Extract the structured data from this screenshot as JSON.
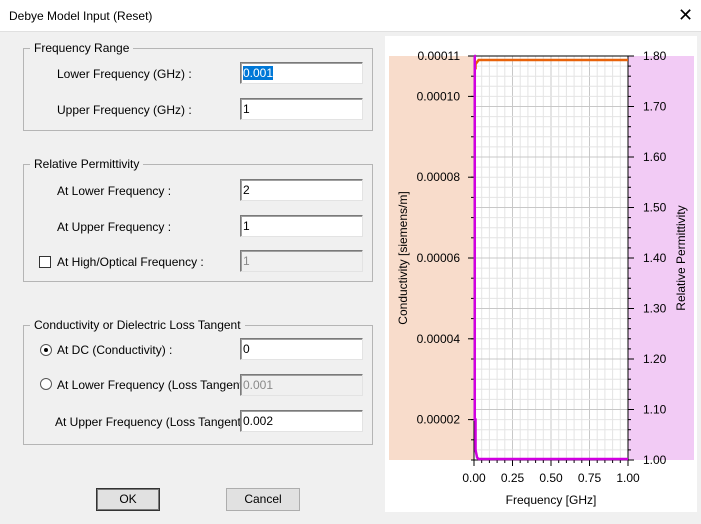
{
  "window": {
    "title": "Debye Model Input (Reset)",
    "close_icon": "close-icon"
  },
  "frequency_range": {
    "legend": "Frequency Range",
    "lower_label": "Lower Frequency (GHz) :",
    "lower_value": "0.001",
    "upper_label": "Upper Frequency (GHz) :",
    "upper_value": "1"
  },
  "relative_permittivity": {
    "legend": "Relative Permittivity",
    "lower_label": "At Lower Frequency :",
    "lower_value": "2",
    "upper_label": "At Upper Frequency :",
    "upper_value": "1",
    "optical_label": "At High/Optical Frequency :",
    "optical_value": "1",
    "optical_checked": false
  },
  "conductivity": {
    "legend": "Conductivity or Dielectric Loss Tangent",
    "dc_label": "At DC (Conductivity) :",
    "dc_value": "0",
    "dc_selected": true,
    "lower_label": "At Lower Frequency (Loss Tangent) :",
    "lower_value": "0.001",
    "upper_label": "At Upper Frequency (Loss Tangent) :",
    "upper_value": "0.002"
  },
  "buttons": {
    "ok": "OK",
    "cancel": "Cancel"
  },
  "chart_data": {
    "type": "line",
    "xlabel": "Frequency [GHz]",
    "ylabel_left": "Conductivity [siemens/m]",
    "ylabel_right": "Relative Permittivity",
    "xlim": [
      0,
      1
    ],
    "ylim_left": [
      1e-05,
      0.00011
    ],
    "ylim_right": [
      1.0,
      1.8
    ],
    "x_ticks": [
      "0.00",
      "0.25",
      "0.50",
      "0.75",
      "1.00"
    ],
    "y_left_ticks": [
      "0.00011",
      "0.00010",
      "0.00008",
      "0.00006",
      "0.00004",
      "0.00002"
    ],
    "y_left_tick_values": [
      0.00011,
      0.0001,
      8e-05,
      6e-05,
      4e-05,
      2e-05
    ],
    "y_right_ticks": [
      "1.80",
      "1.70",
      "1.60",
      "1.50",
      "1.40",
      "1.30",
      "1.20",
      "1.10",
      "1.00"
    ],
    "grid": true,
    "colors": {
      "conductivity": "#e8620a",
      "permittivity": "#d000e0",
      "left_band": "#f8dccb",
      "right_band": "#f2cbf5"
    },
    "series": [
      {
        "axis": "left",
        "x": [
          0.001,
          0.005,
          0.005,
          0.01,
          0.01,
          0.02,
          0.03,
          1.0
        ],
        "y": [
          0.000102,
          0.000102,
          0.000107,
          0.000107,
          0.000108,
          0.0001085,
          0.000109,
          0.000109
        ]
      },
      {
        "axis": "right",
        "x": [
          0.001,
          0.005,
          0.005,
          0.01,
          0.01,
          0.02,
          0.03,
          1.0
        ],
        "y": [
          1.8,
          1.8,
          1.08,
          1.08,
          1.02,
          1.005,
          1.002,
          1.002
        ]
      }
    ]
  }
}
